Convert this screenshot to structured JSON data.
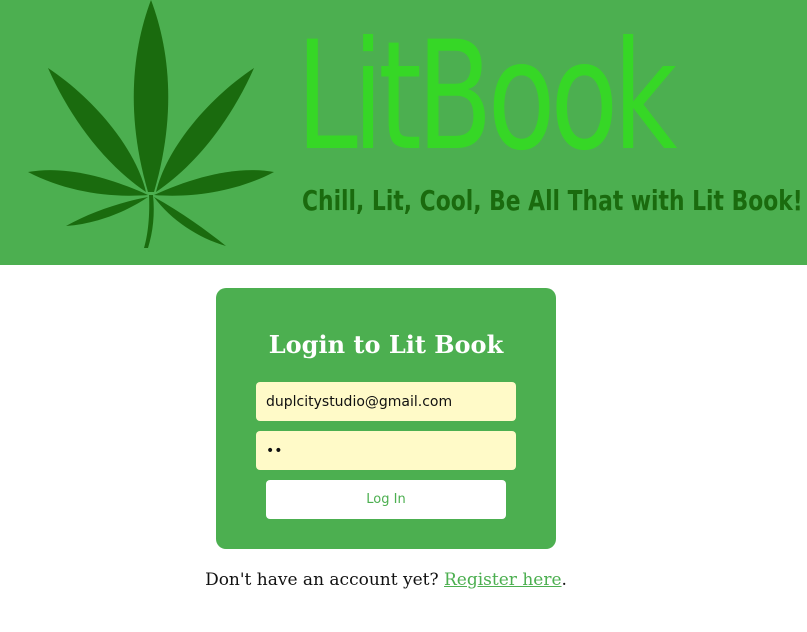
{
  "header": {
    "brand_title": "LitBook",
    "tagline": "Chill, Lit, Cool, Be All That with Lit Book!",
    "logo_icon": "cannabis-leaf-icon"
  },
  "login": {
    "title": "Login to Lit Book",
    "email_value": "duplcitystudio@gmail.com",
    "password_value": "ab",
    "button_label": "Log In"
  },
  "register": {
    "prompt": "Don't have an account yet?",
    "link_label": "Register here",
    "suffix": "."
  },
  "colors": {
    "brand_green": "#4caf50",
    "title_green": "#36d726",
    "leaf_dark_green": "#1a6b0e",
    "input_bg": "#fffac8"
  }
}
